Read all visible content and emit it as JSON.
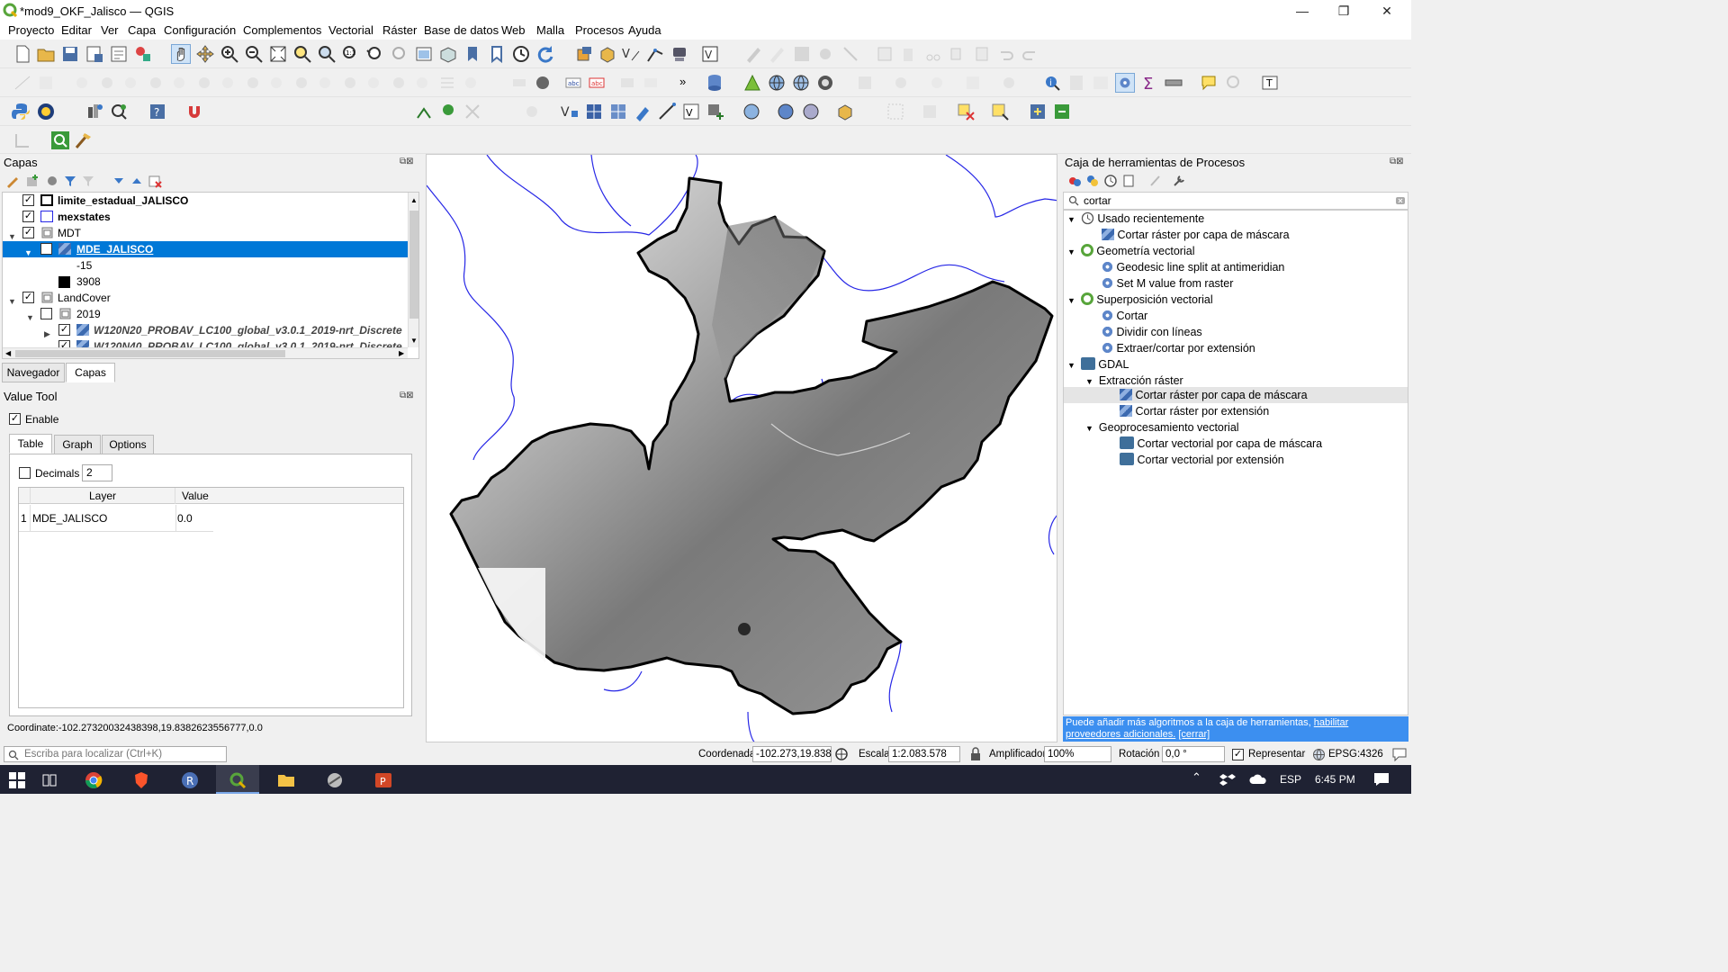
{
  "window": {
    "title": "*mod9_OKF_Jalisco — QGIS",
    "min": "—",
    "max": "❐",
    "close": "✕"
  },
  "menu": [
    "Proyecto",
    "Editar",
    "Ver",
    "Capa",
    "Configuración",
    "Complementos",
    "Vectorial",
    "Ráster",
    "Base de datos",
    "Web",
    "Malla",
    "Procesos",
    "Ayuda"
  ],
  "toolbar": {
    "font_size": "12",
    "unit": "px"
  },
  "layers_panel": {
    "title": "Capas",
    "items": [
      {
        "label": "limite_estadual_JALISCO",
        "bold": true
      },
      {
        "label": "mexstates",
        "bold": true
      },
      {
        "label": "MDT"
      },
      {
        "label": "MDE_JALISCO"
      },
      {
        "label": "-15"
      },
      {
        "label": "3908"
      },
      {
        "label": "LandCover"
      },
      {
        "label": "2019"
      },
      {
        "label": "W120N20_PROBAV_LC100_global_v3.0.1_2019-nrt_Discrete"
      },
      {
        "label": "W120N40_PROBAV_LC100_global_v3.0.1_2019-nrt_Discrete"
      }
    ],
    "tabs": [
      "Navegador",
      "Capas"
    ]
  },
  "value_tool": {
    "title": "Value Tool",
    "enable": "Enable",
    "tabs": [
      "Table",
      "Graph",
      "Options"
    ],
    "decimals_label": "Decimals",
    "decimals_value": "2",
    "col_layer": "Layer",
    "col_value": "Value",
    "rows": [
      {
        "n": "1",
        "layer": "MDE_JALISCO",
        "value": "0.0"
      }
    ],
    "coordinate": "Coordinate:-102.27320032438398,19.8382623556777,0.0"
  },
  "processing": {
    "title": "Caja de herramientas de Procesos",
    "search": "cortar",
    "tree": [
      {
        "label": "Usado recientemente",
        "lvl": 0
      },
      {
        "label": "Cortar ráster por capa de máscara",
        "lvl": 1
      },
      {
        "label": "Geometría vectorial",
        "lvl": 0
      },
      {
        "label": "Geodesic line split at antimeridian",
        "lvl": 1
      },
      {
        "label": "Set M value from raster",
        "lvl": 1
      },
      {
        "label": "Superposición vectorial",
        "lvl": 0
      },
      {
        "label": "Cortar",
        "lvl": 1
      },
      {
        "label": "Dividir con líneas",
        "lvl": 1
      },
      {
        "label": "Extraer/cortar por extensión",
        "lvl": 1
      },
      {
        "label": "GDAL",
        "lvl": 0
      },
      {
        "label": "Extracción ráster",
        "lvl": 1
      },
      {
        "label": "Cortar ráster por capa de máscara",
        "lvl": 2
      },
      {
        "label": "Cortar ráster por extensión",
        "lvl": 2
      },
      {
        "label": "Geoprocesamiento vectorial",
        "lvl": 1
      },
      {
        "label": "Cortar vectorial por capa de máscara",
        "lvl": 2
      },
      {
        "label": "Cortar vectorial por extensión",
        "lvl": 2
      }
    ],
    "notice_text": "Puede añadir más algoritmos a la caja de herramientas,",
    "notice_link": "habilitar proveedores adicionales.",
    "notice_close": "[cerrar]"
  },
  "statusbar": {
    "locate_placeholder": "Escriba para localizar (Ctrl+K)",
    "coord_label": "Coordenada",
    "coord_value": "-102.273,19.838",
    "scale_label": "Escala",
    "scale_value": "1:2.083.578",
    "magnifier_label": "Amplificador",
    "magnifier_value": "100%",
    "rotation_label": "Rotación",
    "rotation_value": "0,0 °",
    "render_label": "Representar",
    "crs": "EPSG:4326"
  },
  "taskbar": {
    "lang": "ESP",
    "time": "6:45 PM"
  },
  "colors": {
    "selection": "#0078d7",
    "link": "#0000ee",
    "notice_bg": "#3c8ff0",
    "state_border": "#000000",
    "states_line": "#2727e6"
  }
}
